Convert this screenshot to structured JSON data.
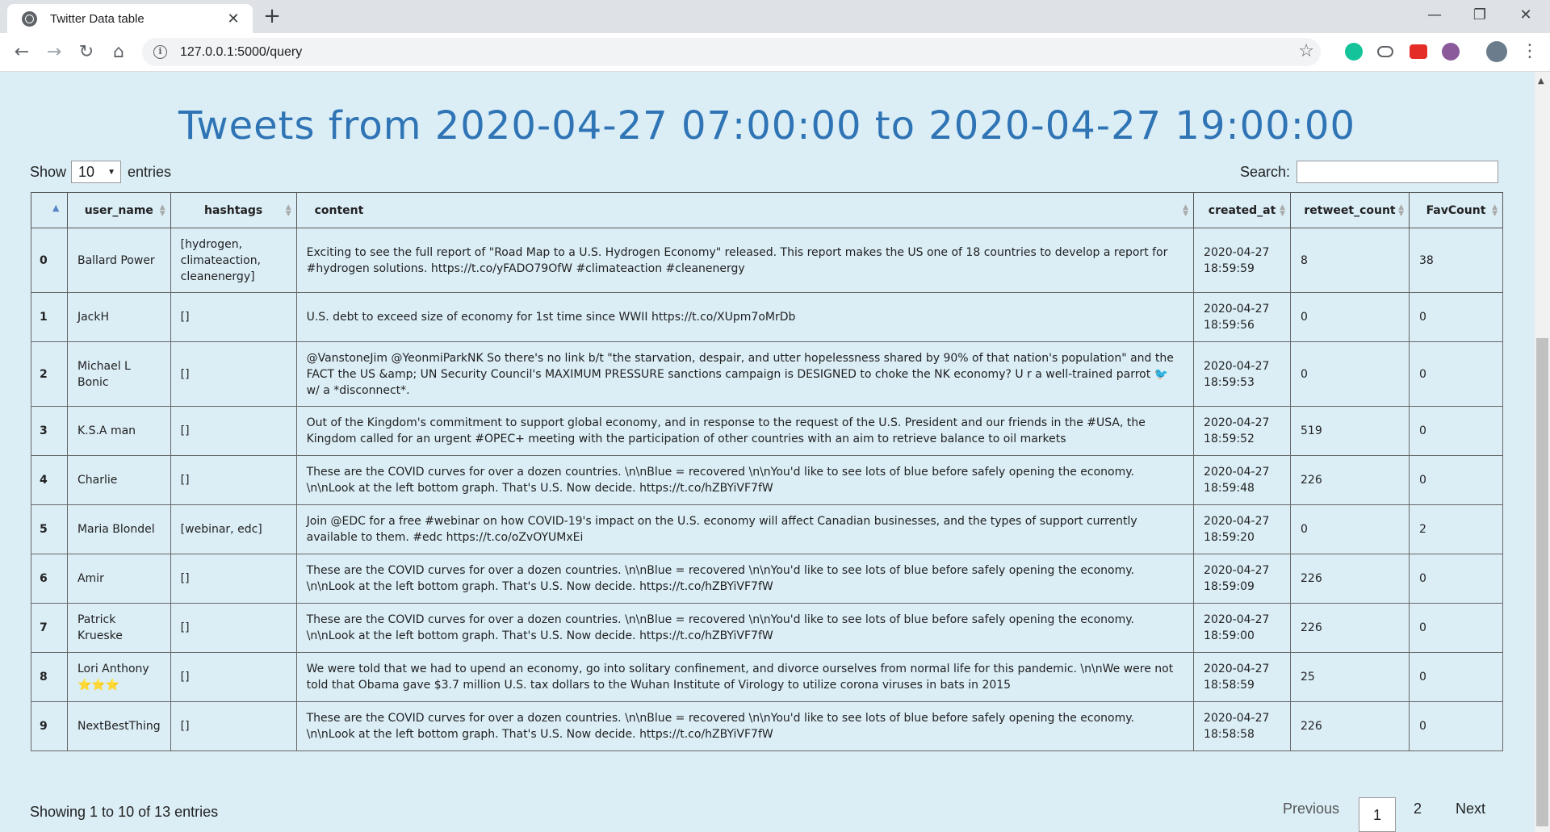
{
  "browser": {
    "tab_title": "Twitter Data table",
    "url": "127.0.0.1:5000/query"
  },
  "page": {
    "title": "Tweets from 2020-04-27 07:00:00 to 2020-04-27 19:00:00",
    "show_label": "Show",
    "entries_label": "entries",
    "page_length": "10",
    "search_label": "Search:",
    "search_value": ""
  },
  "table": {
    "columns": [
      "",
      "user_name",
      "hashtags",
      "content",
      "created_at",
      "retweet_count",
      "FavCount"
    ],
    "rows": [
      {
        "idx": "0",
        "user": "Ballard Power",
        "tags": "[hydrogen, climateaction, cleanenergy]",
        "content": "Exciting to see the full report of \"Road Map to a U.S. Hydrogen Economy\" released. This report makes the US one of 18 countries to develop a report for #hydrogen solutions. https://t.co/yFADO79OfW #climateaction #cleanenergy",
        "date": "2020-04-27",
        "time": "18:59:59",
        "rt": "8",
        "fav": "38"
      },
      {
        "idx": "1",
        "user": "JackH",
        "tags": "[]",
        "content": "U.S. debt to exceed size of economy for 1st time since WWII https://t.co/XUpm7oMrDb",
        "date": "2020-04-27",
        "time": "18:59:56",
        "rt": "0",
        "fav": "0"
      },
      {
        "idx": "2",
        "user": "Michael L Bonic",
        "tags": "[]",
        "content": "@VanstoneJim @YeonmiParkNK So there's no link b/t \"the starvation, despair, and utter hopelessness shared by 90% of that nation's population\" and the FACT the US &amp; UN Security Council's MAXIMUM PRESSURE sanctions campaign is DESIGNED to choke the NK economy? U r a well-trained parrot 🐦 w/ a *disconnect*.",
        "date": "2020-04-27",
        "time": "18:59:53",
        "rt": "0",
        "fav": "0"
      },
      {
        "idx": "3",
        "user": "K.S.A man",
        "tags": "[]",
        "content": "Out of the Kingdom's commitment to support global economy, and in response to the request of the U.S. President and our friends in the #USA, the Kingdom called for an urgent #OPEC+ meeting with the participation of other countries with an aim to retrieve balance to oil markets",
        "date": "2020-04-27",
        "time": "18:59:52",
        "rt": "519",
        "fav": "0"
      },
      {
        "idx": "4",
        "user": "Charlie",
        "tags": "[]",
        "content": "These are the COVID curves for over a dozen countries. \\n\\nBlue = recovered \\n\\nYou'd like to see lots of blue before safely opening the economy. \\n\\nLook at the left bottom graph. That's U.S. Now decide. https://t.co/hZBYiVF7fW",
        "date": "2020-04-27",
        "time": "18:59:48",
        "rt": "226",
        "fav": "0"
      },
      {
        "idx": "5",
        "user": "Maria Blondel",
        "tags": "[webinar, edc]",
        "content": "Join @EDC for a free #webinar on how COVID-19's impact on the U.S. economy will affect Canadian businesses, and the types of support currently available to them. #edc https://t.co/oZvOYUMxEi",
        "date": "2020-04-27",
        "time": "18:59:20",
        "rt": "0",
        "fav": "2"
      },
      {
        "idx": "6",
        "user": "Amir",
        "tags": "[]",
        "content": "These are the COVID curves for over a dozen countries. \\n\\nBlue = recovered \\n\\nYou'd like to see lots of blue before safely opening the economy. \\n\\nLook at the left bottom graph. That's U.S. Now decide. https://t.co/hZBYiVF7fW",
        "date": "2020-04-27",
        "time": "18:59:09",
        "rt": "226",
        "fav": "0"
      },
      {
        "idx": "7",
        "user": "Patrick Krueske",
        "tags": "[]",
        "content": "These are the COVID curves for over a dozen countries. \\n\\nBlue = recovered \\n\\nYou'd like to see lots of blue before safely opening the economy. \\n\\nLook at the left bottom graph. That's U.S. Now decide. https://t.co/hZBYiVF7fW",
        "date": "2020-04-27",
        "time": "18:59:00",
        "rt": "226",
        "fav": "0"
      },
      {
        "idx": "8",
        "user": "Lori Anthony ⭐⭐⭐",
        "tags": "[]",
        "content": "We were told that we had to upend an economy, go into solitary confinement, and divorce ourselves from normal life for this pandemic. \\n\\nWe were not told that Obama gave $3.7 million U.S. tax dollars to the Wuhan Institute of Virology to utilize corona viruses in bats in 2015",
        "date": "2020-04-27",
        "time": "18:58:59",
        "rt": "25",
        "fav": "0"
      },
      {
        "idx": "9",
        "user": "NextBestThing",
        "tags": "[]",
        "content": "These are the COVID curves for over a dozen countries. \\n\\nBlue = recovered \\n\\nYou'd like to see lots of blue before safely opening the economy. \\n\\nLook at the left bottom graph. That's U.S. Now decide. https://t.co/hZBYiVF7fW",
        "date": "2020-04-27",
        "time": "18:58:58",
        "rt": "226",
        "fav": "0"
      }
    ]
  },
  "footer": {
    "info": "Showing 1 to 10 of 13 entries",
    "previous": "Previous",
    "pages": [
      "1",
      "2"
    ],
    "next": "Next"
  }
}
